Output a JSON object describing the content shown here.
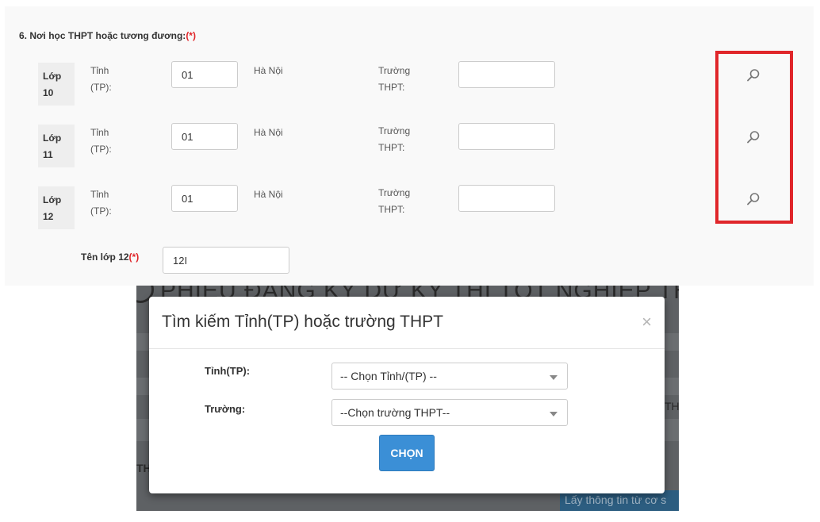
{
  "section": {
    "title": "6. Nơi học THPT hoặc tương đương:",
    "required_mark": "(*)"
  },
  "rows": [
    {
      "grade_label": "Lớp",
      "grade_number": "10",
      "province_label_1": "Tỉnh",
      "province_label_2": "(TP):",
      "province_code": "01",
      "province_name": "Hà Nội",
      "school_label_1": "Trường",
      "school_label_2": "THPT:",
      "school_value": ""
    },
    {
      "grade_label": "Lớp",
      "grade_number": "11",
      "province_label_1": "Tỉnh",
      "province_label_2": "(TP):",
      "province_code": "01",
      "province_name": "Hà Nội",
      "school_label_1": "Trường",
      "school_label_2": "THPT:",
      "school_value": ""
    },
    {
      "grade_label": "Lớp",
      "grade_number": "12",
      "province_label_1": "Tỉnh",
      "province_label_2": "(TP):",
      "province_code": "01",
      "province_name": "Hà Nội",
      "school_label_1": "Trường",
      "school_label_2": "THPT:",
      "school_value": ""
    }
  ],
  "class_name": {
    "label": "Tên lớp 12",
    "required_mark": "(*)",
    "value": "12I"
  },
  "background_page": {
    "header_text": "PHIẾU ĐĂNG KÝ DỰ KỲ THI TỐT NGHIỆP THPT",
    "side_text_left": "TH",
    "side_text_right": "TH",
    "button_text": "Lấy thông tin từ cơ s"
  },
  "modal": {
    "title": "Tìm kiếm Tỉnh(TP) hoặc trường THPT",
    "close_symbol": "×",
    "province_label": "Tỉnh(TP):",
    "province_select": "-- Chọn Tỉnh/(TP) --",
    "school_label": "Trường:",
    "school_select": "--Chọn trường THPT--",
    "choose_button": "CHỌN"
  },
  "colors": {
    "highlight_frame": "#e0262a",
    "required": "#e0262a",
    "primary_button": "#3b8fd6"
  },
  "icons": {
    "search": "search-icon",
    "dropdown": "chevron-down-icon"
  }
}
